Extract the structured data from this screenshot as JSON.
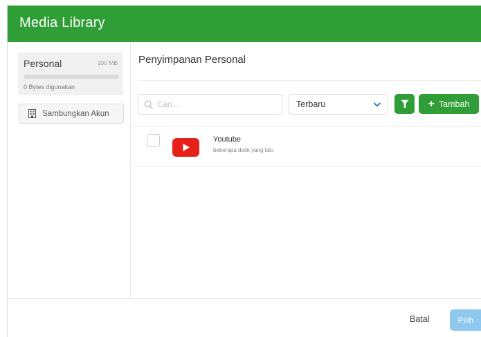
{
  "header": {
    "title": "Media Library"
  },
  "sidebar": {
    "storage": {
      "name": "Personal",
      "capacity": "100 MB",
      "used_text": "0 Bytes digunakan",
      "used_fraction": 0
    },
    "connect_button": {
      "label": "Sambungkan Akun",
      "icon": "building-icon"
    }
  },
  "main": {
    "title": "Penyimpanan Personal",
    "search": {
      "placeholder": "Cari...",
      "value": "",
      "icon": "search-icon"
    },
    "sort": {
      "selected": "Terbaru",
      "icon": "chevron-down-icon"
    },
    "filter_button": {
      "icon": "filter-icon"
    },
    "add_button": {
      "label": "Tambah",
      "icon": "plus-icon"
    },
    "files": [
      {
        "name": "Youtube",
        "time": "beberapa detik yang lalu",
        "icon": "youtube-icon",
        "checked": false
      }
    ]
  },
  "footer": {
    "cancel_label": "Batal",
    "select_label": "Pilih"
  },
  "colors": {
    "accent": "#2f9e36",
    "select_disabled": "#8fc8ef",
    "youtube_red": "#e62117"
  }
}
